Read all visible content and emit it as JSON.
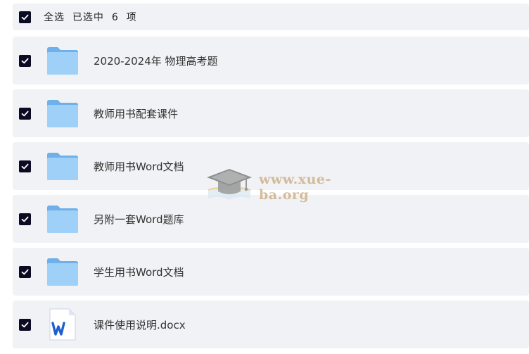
{
  "selection": {
    "select_all_label": "全选",
    "selected_prefix": "已选中",
    "selected_count": "6",
    "selected_suffix": "项"
  },
  "files": [
    {
      "label": "2020-2024年 物理高考题",
      "type": "folder",
      "checked": true
    },
    {
      "label": "教师用书配套课件",
      "type": "folder",
      "checked": true
    },
    {
      "label": "教师用书Word文档",
      "type": "folder",
      "checked": true
    },
    {
      "label": "另附一套Word题库",
      "type": "folder",
      "checked": true
    },
    {
      "label": "学生用书Word文档",
      "type": "folder",
      "checked": true
    },
    {
      "label": "课件使用说明.docx",
      "type": "word-document",
      "checked": true
    }
  ],
  "watermark": {
    "text": "www.xue-ba.org",
    "icon": "graduation-cap-icon"
  },
  "colors": {
    "checkbox": "#0b0b24",
    "row_background": "#f1f2f5",
    "folder": "#8ec5f2",
    "word_blue": "#1e5fd0",
    "watermark": "#c9a87a"
  }
}
